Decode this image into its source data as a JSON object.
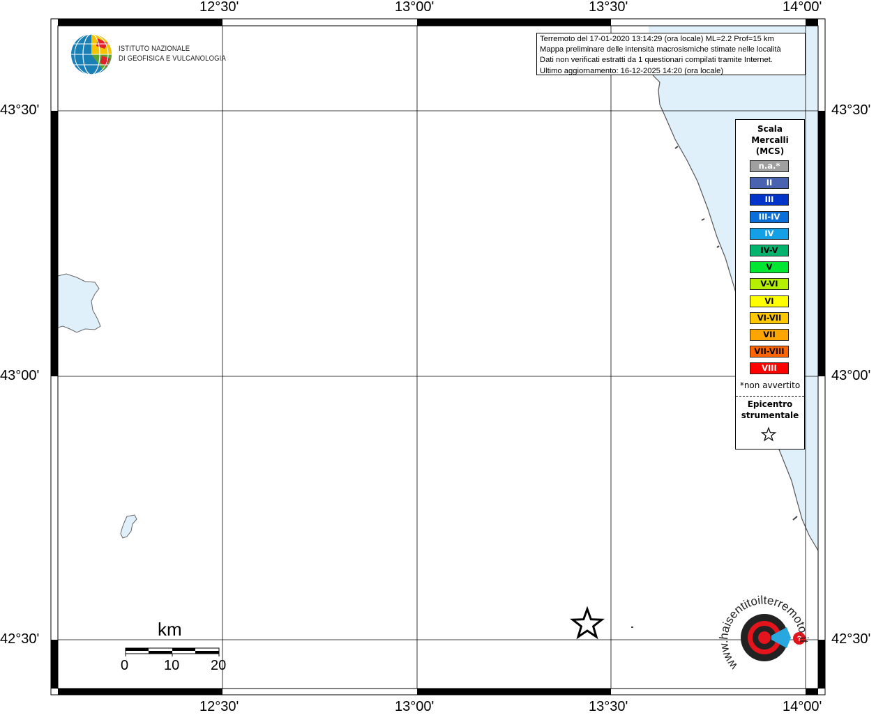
{
  "map": {
    "top_lon_labels": [
      "12°30'",
      "13°00'",
      "13°30'",
      "14°00'"
    ],
    "bottom_lon_labels": [
      "12°30'",
      "13°00'",
      "13°30'",
      "14°00'"
    ],
    "left_lat_labels": [
      "43°30'",
      "43°00'",
      "42°30'"
    ],
    "right_lat_labels": [
      "43°30'",
      "43°00'",
      "42°30'"
    ]
  },
  "logo": {
    "line1": "ISTITUTO NAZIONALE",
    "line2": "DI GEOFISICA E VULCANOLOGIA"
  },
  "info": {
    "line1": "Terremoto del 17-01-2020 13:14:29 (ora locale) ML=2.2 Prof=15 km",
    "line2": "Mappa preliminare delle intensità macrosismiche stimate nelle località",
    "line3": "Dati non verificati estratti da 1 questionari compilati tramite Internet.",
    "line4": "Ultimo aggiornamento: 16-12-2025 14:20 (ora locale)"
  },
  "legend": {
    "title_line1": "Scala",
    "title_line2": "Mercalli",
    "title_line3": "(MCS)",
    "items": [
      {
        "label": "n.a.*",
        "color": "#a0a0a0",
        "text_color": "#ffffff"
      },
      {
        "label": "II",
        "color": "#4a63b0",
        "text_color": "#ffffff"
      },
      {
        "label": "III",
        "color": "#0033c8",
        "text_color": "#ffffff"
      },
      {
        "label": "III-IV",
        "color": "#0a6fd8",
        "text_color": "#ffffff"
      },
      {
        "label": "IV",
        "color": "#14a0e6",
        "text_color": "#ffffff"
      },
      {
        "label": "IV-V",
        "color": "#00b46e",
        "text_color": "#000000"
      },
      {
        "label": "V",
        "color": "#00e632",
        "text_color": "#000000"
      },
      {
        "label": "V-VI",
        "color": "#b4f000",
        "text_color": "#000000"
      },
      {
        "label": "VI",
        "color": "#ffff00",
        "text_color": "#000000"
      },
      {
        "label": "VI-VII",
        "color": "#ffc800",
        "text_color": "#000000"
      },
      {
        "label": "VII",
        "color": "#ffa500",
        "text_color": "#000000"
      },
      {
        "label": "VII-VIII",
        "color": "#ff6400",
        "text_color": "#000000"
      },
      {
        "label": "VIII",
        "color": "#ff0000",
        "text_color": "#ffffff"
      }
    ],
    "note": "*non avvertito",
    "epicenter_line1": "Epicentro",
    "epicenter_line2": "strumentale"
  },
  "scale_bar": {
    "unit": "km",
    "ticks": [
      "0",
      "10",
      "20"
    ]
  },
  "colors": {
    "water": "#dff0fb",
    "coast": "#555555",
    "frame": "#000000"
  },
  "icons": {
    "epicenter": "star-outline-icon",
    "ingv_logo": "globe-logo-icon",
    "site_logo": "target-logo-icon"
  },
  "site_logo": {
    "text": "www.haisentitoilterremoto.it"
  }
}
